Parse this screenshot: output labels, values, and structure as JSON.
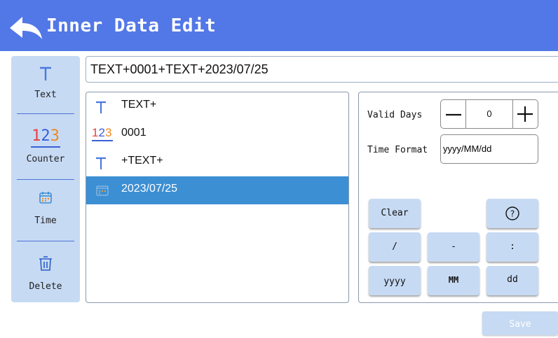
{
  "header": {
    "title": "Inner Data Edit",
    "back_icon": "back-arrow-icon"
  },
  "sidebar": {
    "items": [
      {
        "label": "Text",
        "icon": "text-icon",
        "icon_text": "T"
      },
      {
        "label": "Counter",
        "icon": "counter-icon",
        "icon_text": "123"
      },
      {
        "label": "Time",
        "icon": "calendar-icon"
      },
      {
        "label": "Delete",
        "icon": "trash-icon"
      }
    ]
  },
  "expression": {
    "value": "TEXT+0001+TEXT+2023/07/25"
  },
  "segments": [
    {
      "type": "text",
      "icon_text": "T",
      "value": "TEXT+",
      "selected": false
    },
    {
      "type": "counter",
      "icon_text": "123",
      "value": "0001",
      "selected": false
    },
    {
      "type": "text",
      "icon_text": "T",
      "value": "+TEXT+",
      "selected": false
    },
    {
      "type": "time",
      "value": "2023/07/25",
      "selected": true
    }
  ],
  "settings": {
    "valid_days_label": "Valid Days",
    "valid_days_value": "0",
    "time_format_label": "Time Format",
    "time_format_value": "yyyy/MM/dd"
  },
  "keypad": {
    "clear": "Clear",
    "help": "?",
    "slash": "/",
    "dash": "-",
    "colon": ":",
    "yyyy": "yyyy",
    "mm": "MM",
    "dd": "dd"
  },
  "save_label": "Save",
  "colors": {
    "header": "#5277e6",
    "panel_bg": "#c7daf3",
    "selection": "#3c8fd3",
    "text_icon": "#4a78e0",
    "counter_red": "#e84040",
    "counter_blue": "#3a5fd8",
    "counter_orange": "#f08a20"
  }
}
